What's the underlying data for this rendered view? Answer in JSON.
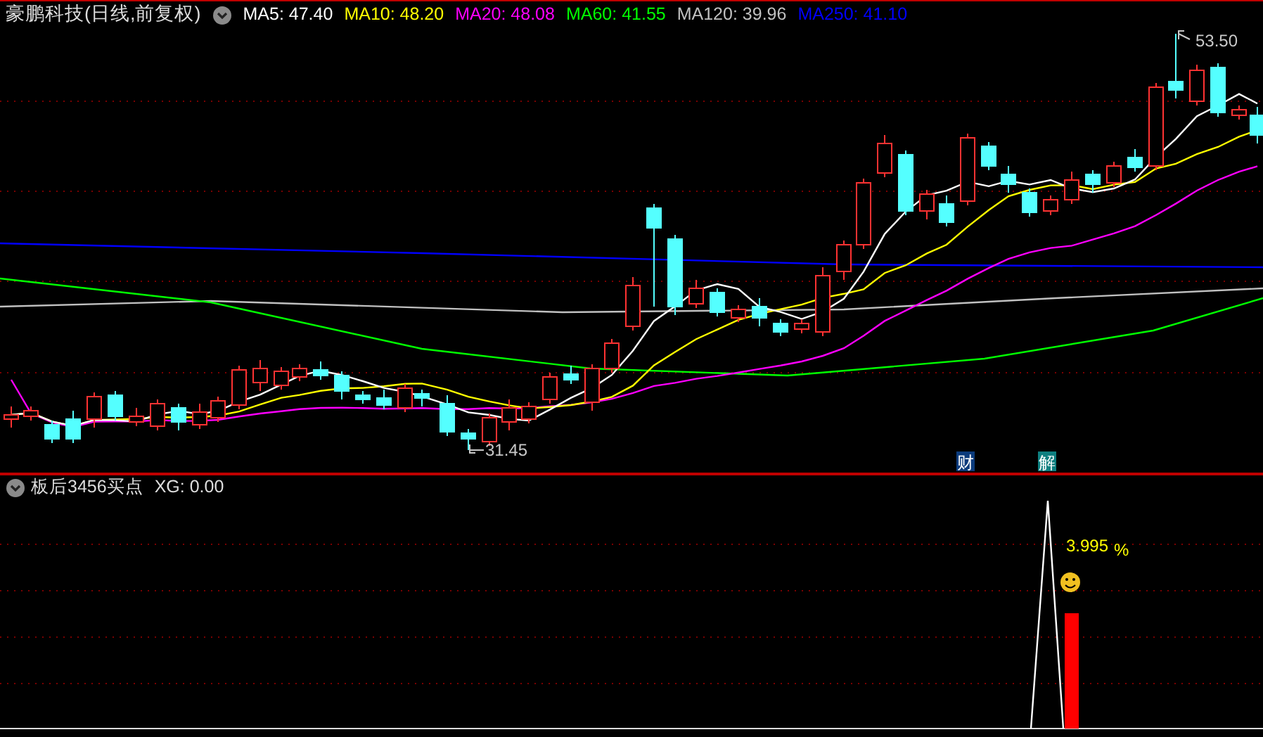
{
  "header": {
    "title": "豪鹏科技(日线,前复权)",
    "ma_legend": [
      {
        "label": "MA5: 47.40",
        "color": "#ffffff"
      },
      {
        "label": "MA10: 48.20",
        "color": "#ffff00"
      },
      {
        "label": "MA20: 48.08",
        "color": "#ff00ff"
      },
      {
        "label": "MA60: 41.55",
        "color": "#00ff00"
      },
      {
        "label": "MA120: 39.96",
        "color": "#c0c0c0"
      },
      {
        "label": "MA250: 41.10",
        "color": "#0000ff"
      }
    ]
  },
  "main_chart": {
    "high_label": "53.50",
    "low_label": "31.45",
    "markers": [
      {
        "text": "财",
        "kind": "finance"
      },
      {
        "text": "解",
        "kind": "unlock"
      }
    ]
  },
  "indicator": {
    "title": "板后3456买点",
    "xg": "XG: 0.00",
    "value": "3.995",
    "unit": "%"
  }
}
